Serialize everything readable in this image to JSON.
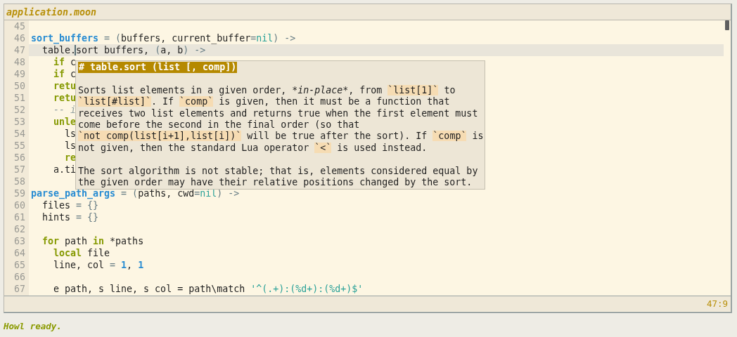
{
  "window": {
    "title": "application.moon"
  },
  "editor": {
    "lines": [
      {
        "number": "45",
        "current": false
      },
      {
        "number": "46",
        "current": false,
        "tokens": [
          {
            "kind": "func",
            "text": "sort_buffers"
          },
          {
            "kind": "op",
            "text": " = ("
          },
          {
            "kind": "plain",
            "text": "buffers, current_buffer"
          },
          {
            "kind": "op",
            "text": "="
          },
          {
            "kind": "const",
            "text": "nil"
          },
          {
            "kind": "op",
            "text": ") ->"
          }
        ]
      },
      {
        "number": "47",
        "current": true,
        "tokens": [
          {
            "kind": "plain",
            "text": "  table."
          },
          {
            "kind": "plain",
            "text": "sort",
            "cursor": true
          },
          {
            "kind": "plain",
            "text": " buffers, "
          },
          {
            "kind": "op",
            "text": "("
          },
          {
            "kind": "plain",
            "text": "a, b"
          },
          {
            "kind": "op",
            "text": ") ->"
          }
        ]
      },
      {
        "number": "48",
        "current": false,
        "tokens": [
          {
            "kind": "keyword",
            "text": "    if"
          },
          {
            "kind": "plain",
            "text": " c"
          }
        ]
      },
      {
        "number": "49",
        "current": false,
        "tokens": [
          {
            "kind": "keyword",
            "text": "    if"
          },
          {
            "kind": "plain",
            "text": " c"
          }
        ]
      },
      {
        "number": "50",
        "current": false,
        "tokens": [
          {
            "kind": "keyword",
            "text": "    retu"
          }
        ]
      },
      {
        "number": "51",
        "current": false,
        "tokens": [
          {
            "kind": "keyword",
            "text": "    retu"
          }
        ]
      },
      {
        "number": "52",
        "current": false,
        "tokens": [
          {
            "kind": "comment",
            "text": "    -- i"
          }
        ]
      },
      {
        "number": "53",
        "current": false,
        "tokens": [
          {
            "kind": "keyword",
            "text": "    unle"
          }
        ]
      },
      {
        "number": "54",
        "current": false,
        "tokens": [
          {
            "kind": "plain",
            "text": "      ls"
          }
        ]
      },
      {
        "number": "55",
        "current": false,
        "tokens": [
          {
            "kind": "plain",
            "text": "      ls"
          }
        ]
      },
      {
        "number": "56",
        "current": false,
        "tokens": [
          {
            "kind": "keyword",
            "text": "      re"
          }
        ]
      },
      {
        "number": "57",
        "current": false,
        "tokens": [
          {
            "kind": "plain",
            "text": "    a.ti"
          }
        ]
      },
      {
        "number": "58",
        "current": false
      },
      {
        "number": "59",
        "current": false,
        "tokens": [
          {
            "kind": "func",
            "text": "parse_path_args"
          },
          {
            "kind": "op",
            "text": " = ("
          },
          {
            "kind": "plain",
            "text": "paths, cwd"
          },
          {
            "kind": "op",
            "text": "="
          },
          {
            "kind": "const",
            "text": "nil"
          },
          {
            "kind": "op",
            "text": ") ->"
          }
        ]
      },
      {
        "number": "60",
        "current": false,
        "tokens": [
          {
            "kind": "plain",
            "text": "  files "
          },
          {
            "kind": "op",
            "text": "= {}"
          }
        ]
      },
      {
        "number": "61",
        "current": false,
        "tokens": [
          {
            "kind": "plain",
            "text": "  hints "
          },
          {
            "kind": "op",
            "text": "= {}"
          }
        ]
      },
      {
        "number": "62",
        "current": false
      },
      {
        "number": "63",
        "current": false,
        "tokens": [
          {
            "kind": "keyword",
            "text": "  for"
          },
          {
            "kind": "plain",
            "text": " path "
          },
          {
            "kind": "keyword",
            "text": "in"
          },
          {
            "kind": "plain",
            "text": " *paths"
          }
        ]
      },
      {
        "number": "64",
        "current": false,
        "tokens": [
          {
            "kind": "keyword",
            "text": "    local"
          },
          {
            "kind": "plain",
            "text": " file"
          }
        ]
      },
      {
        "number": "65",
        "current": false,
        "tokens": [
          {
            "kind": "plain",
            "text": "    line, col "
          },
          {
            "kind": "op",
            "text": "="
          },
          {
            "kind": "number",
            "text": " 1"
          },
          {
            "kind": "plain",
            "text": ","
          },
          {
            "kind": "number",
            "text": " 1"
          }
        ]
      },
      {
        "number": "66",
        "current": false
      },
      {
        "number": "67",
        "current": false,
        "tokens": [
          {
            "kind": "plain",
            "text": "    e path, s line, s col = path\\match "
          },
          {
            "kind": "string",
            "text": "'^(.+):(%d+):(%d+)$'"
          }
        ]
      }
    ]
  },
  "popup": {
    "heading": "# table.sort (list [, comp])",
    "paragraphs": [
      {
        "lines": [
          [
            {
              "kind": "text",
              "text": "Sorts list elements in a given order, *"
            },
            {
              "kind": "em",
              "text": "in-place"
            },
            {
              "kind": "text",
              "text": "*, from "
            },
            {
              "kind": "code",
              "text": "`list[1]`"
            },
            {
              "kind": "text",
              "text": " to"
            }
          ],
          [
            {
              "kind": "code",
              "text": "`list[#list]`"
            },
            {
              "kind": "text",
              "text": ". If "
            },
            {
              "kind": "code",
              "text": "`comp`"
            },
            {
              "kind": "text",
              "text": " is given, then it must be a function that"
            }
          ],
          [
            {
              "kind": "text",
              "text": "receives two list elements and returns true when the first element must"
            }
          ],
          [
            {
              "kind": "text",
              "text": "come before the second in the final order (so that"
            }
          ],
          [
            {
              "kind": "code",
              "text": "`not comp(list[i+1],list[i])`"
            },
            {
              "kind": "text",
              "text": " will be true after the sort). If "
            },
            {
              "kind": "code",
              "text": "`comp`"
            },
            {
              "kind": "text",
              "text": " is"
            }
          ],
          [
            {
              "kind": "text",
              "text": "not given, then the standard Lua operator "
            },
            {
              "kind": "code",
              "text": "`<`"
            },
            {
              "kind": "text",
              "text": " is used instead."
            }
          ]
        ]
      },
      {
        "lines": [
          [
            {
              "kind": "text",
              "text": "The sort algorithm is not stable; that is, elements considered equal by"
            }
          ],
          [
            {
              "kind": "text",
              "text": "the given order may have their relative positions changed by the sort."
            }
          ]
        ]
      }
    ]
  },
  "status_bar": {
    "position": "47:9"
  },
  "message": "Howl ready."
}
